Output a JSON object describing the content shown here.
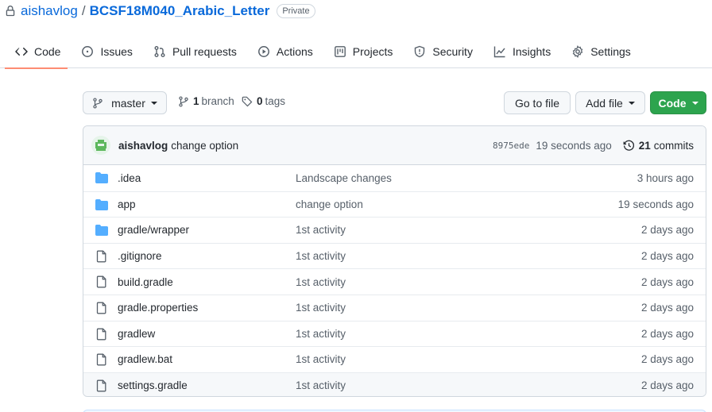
{
  "repo": {
    "owner": "aishavlog",
    "separator": "/",
    "name": "BCSF18M040_Arabic_Letter",
    "visibility": "Private"
  },
  "tabs": [
    {
      "label": "Code",
      "icon": "code-icon",
      "active": true
    },
    {
      "label": "Issues",
      "icon": "issue-icon"
    },
    {
      "label": "Pull requests",
      "icon": "pull-request-icon"
    },
    {
      "label": "Actions",
      "icon": "play-icon"
    },
    {
      "label": "Projects",
      "icon": "project-icon"
    },
    {
      "label": "Security",
      "icon": "shield-icon"
    },
    {
      "label": "Insights",
      "icon": "graph-icon"
    },
    {
      "label": "Settings",
      "icon": "gear-icon"
    }
  ],
  "toolbar": {
    "branch_name": "master",
    "branch_count": "1",
    "branch_label": "branch",
    "tag_count": "0",
    "tag_label": "tags",
    "go_to_file": "Go to file",
    "add_file": "Add file",
    "code": "Code"
  },
  "latest_commit": {
    "author": "aishavlog",
    "message": "change option",
    "sha": "8975ede",
    "time": "19 seconds ago",
    "commit_count": "21",
    "commit_label": "commits"
  },
  "files": [
    {
      "name": ".idea",
      "type": "folder",
      "message": "Landscape changes",
      "age": "3 hours ago"
    },
    {
      "name": "app",
      "type": "folder",
      "message": "change option",
      "age": "19 seconds ago"
    },
    {
      "name": "gradle/wrapper",
      "type": "folder",
      "message": "1st activity",
      "age": "2 days ago"
    },
    {
      "name": ".gitignore",
      "type": "file",
      "message": "1st activity",
      "age": "2 days ago"
    },
    {
      "name": "build.gradle",
      "type": "file",
      "message": "1st activity",
      "age": "2 days ago"
    },
    {
      "name": "gradle.properties",
      "type": "file",
      "message": "1st activity",
      "age": "2 days ago"
    },
    {
      "name": "gradlew",
      "type": "file",
      "message": "1st activity",
      "age": "2 days ago"
    },
    {
      "name": "gradlew.bat",
      "type": "file",
      "message": "1st activity",
      "age": "2 days ago"
    },
    {
      "name": "settings.gradle",
      "type": "file",
      "message": "1st activity",
      "age": "2 days ago"
    }
  ],
  "colors": {
    "link": "#0969da",
    "primary_button": "#2da44e",
    "folder": "#54aeff",
    "active_tab_underline": "#fd8c73"
  }
}
